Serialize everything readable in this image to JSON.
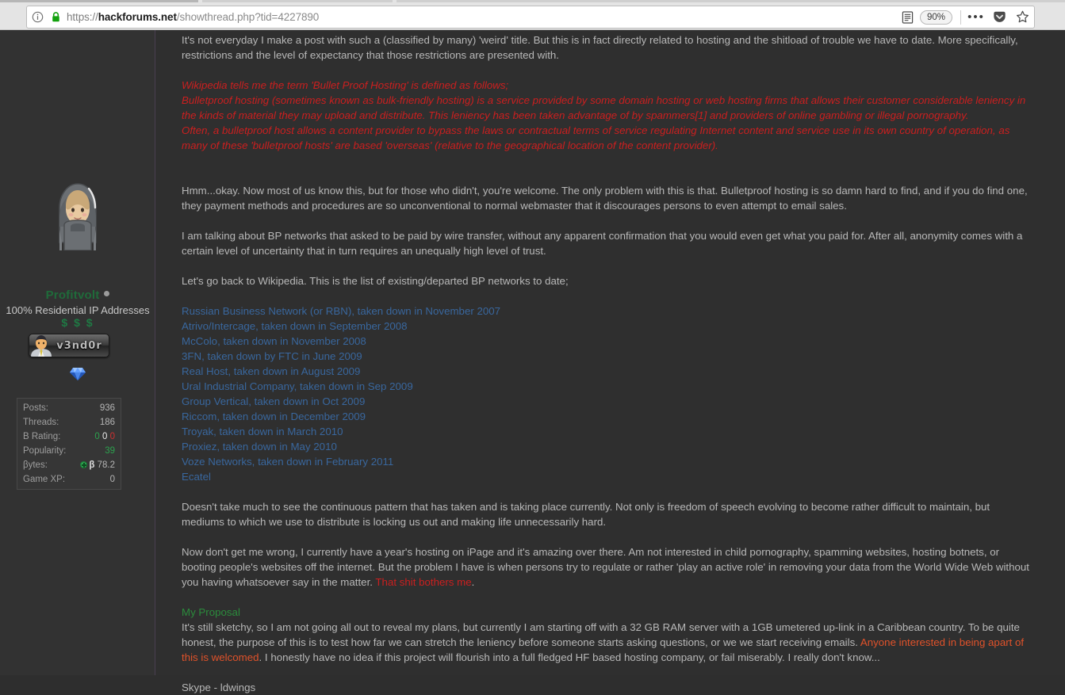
{
  "browser": {
    "url": {
      "scheme": "https://",
      "host": "hackforums.net",
      "path": "/showthread.php?tid=4227890"
    },
    "zoom_level": "90%",
    "icons": {
      "identity": "info-icon",
      "security": "lock-icon",
      "reader": "reader-view-icon",
      "more": "•••",
      "pocket": "pocket-icon",
      "bookmark": "star-icon"
    }
  },
  "sidebar": {
    "avatar_name": "hooded-figure-avatar",
    "username": "Profitvolt",
    "online_status": "online-indicator",
    "usertitle": "100% Residential IP Addresses",
    "stars": "$ $ $",
    "vendor_badge_label": "v3nd0r",
    "gem_icon": "blue-gem-icon",
    "stats": [
      {
        "label": "Posts:",
        "value": "936",
        "type": "plain"
      },
      {
        "label": "Threads:",
        "value": "186",
        "type": "plain"
      },
      {
        "label": "B Rating:",
        "value": "0 0 0",
        "type": "rating",
        "positive": "0",
        "neutral": "0",
        "negative": "0"
      },
      {
        "label": "Popularity:",
        "value": "39",
        "type": "popularity"
      },
      {
        "label": "βytes:",
        "value": "78.2",
        "type": "bytes",
        "symbol": "β"
      },
      {
        "label": "Game XP:",
        "value": "0",
        "type": "plain"
      }
    ]
  },
  "post": {
    "intro": "It's not everyday I make a post with such a (classified by many) 'weird' title. But this is in fact directly related to hosting and the shitload of trouble we have to date. More specifically, restrictions and the level of expectancy that those restrictions are presented with.",
    "wiki_quote": [
      "Wikipedia tells me the term 'Bullet Proof Hosting' is defined as follows;",
      "Bulletproof hosting (sometimes known as bulk-friendly hosting) is a service provided by some domain hosting or web hosting firms that allows their customer considerable leniency in the kinds of material they may upload and distribute. This leniency has been taken advantage of by spammers[1] and providers of online gambling or illegal pornography.",
      "Often, a bulletproof host allows a content provider to bypass the laws or contractual terms of service regulating Internet content and service use in its own country of operation, as many of these 'bulletproof hosts' are based 'overseas' (relative to the geographical location of the content provider)."
    ],
    "para_hmm": "Hmm...okay. Now most of us know this, but for those who didn't, you're welcome. The only problem with this is that. Bulletproof hosting is so damn hard to find, and if you do find one, they payment methods and procedures are so unconventional to normal webmaster that it discourages persons to even attempt to email sales.",
    "para_bp": "I am talking about BP networks that asked to be paid by wire transfer, without any apparent confirmation that you would even get what you paid for. After all, anonymity comes with a certain level of uncertainty that in turn requires an unequally high level of trust.",
    "para_list_intro": "Let's go back to Wikipedia. This is the list of existing/departed BP networks to date;",
    "bp_networks": [
      "Russian Business Network (or RBN), taken down in November 2007",
      "Atrivo/Intercage, taken down in September 2008",
      "McColo, taken down in November 2008",
      "3FN, taken down by FTC in June 2009",
      "Real Host, taken down in August 2009",
      "Ural Industrial Company, taken down in Sep 2009",
      "Group Vertical, taken down in Oct 2009",
      "Riccom, taken down in December 2009",
      "Troyak, taken down in March 2010",
      "Proxiez, taken down in May 2010",
      "Voze Networks, taken down in February 2011",
      "Ecatel"
    ],
    "para_pattern": "Doesn't take much to see the continuous pattern that has taken and is taking place currently. Not only is freedom of speech evolving to become rather difficult to maintain, but mediums to which we use to distribute is locking us out and making life unnecessarily hard.",
    "para_ipage_1": "Now don't get me wrong, I currently have a year's hosting on iPage and it's amazing over there. Am not interested in child pornography, spamming websites, hosting botnets, or booting people's websites off the internet. But the problem I have is when persons try to regulate or rather 'play an active role' in removing your data from the World Wide Web without you having whatsoever say in the matter. ",
    "para_ipage_highlight": "That shit bothers me",
    "para_ipage_2": ".",
    "proposal_heading": "My Proposal",
    "proposal_1": "It's still sketchy, so I am not going all out to reveal my plans, but currently I am starting off with a 32 GB RAM server with a 1GB umetered up-link in a Caribbean country. To be quite honest, the purpose of this is to test how far we can stretch the leniency before someone starts asking questions, or we we start receiving emails. ",
    "proposal_highlight": "Anyone interested in being apart of this is welcomed",
    "proposal_2": ". I honestly have no idea if this project will flourish into a full fledged HF based hosting company, or fail miserably. I really don't know...",
    "skype": "Skype - ldwings"
  },
  "colors": {
    "page_bg": "#2f2f2f",
    "sidebar_bg": "#323232",
    "body_text": "#b8b8b8",
    "link_blue": "#39679e",
    "quote_red": "#cc1f1f",
    "highlight_orange": "#e0522a",
    "heading_green": "#2b8c3c",
    "username_green": "#1f6b3a"
  }
}
